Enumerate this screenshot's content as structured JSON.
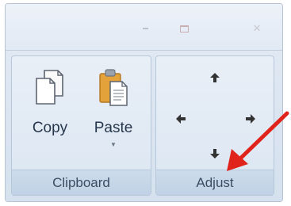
{
  "window": {
    "controls": {
      "minimize_icon": "minimize-icon",
      "maximize_icon": "maximize-icon",
      "close_icon": "close-icon"
    }
  },
  "ribbon": {
    "clipboard": {
      "label": "Clipboard",
      "copy": {
        "label": "Copy",
        "icon": "copy-icon"
      },
      "paste": {
        "label": "Paste",
        "icon": "paste-icon",
        "dropdown_icon": "chevron-down-icon"
      }
    },
    "adjust": {
      "label": "Adjust",
      "arrows": [
        "arrow-up-icon",
        "arrow-left-icon",
        "arrow-right-icon",
        "arrow-down-icon"
      ]
    }
  },
  "annotation": {
    "pointer_color": "#e0241b"
  },
  "colors": {
    "ribbon_bg": "#dde6f1",
    "group_label_bg": "#c7d7e9",
    "text": "#26364c"
  }
}
